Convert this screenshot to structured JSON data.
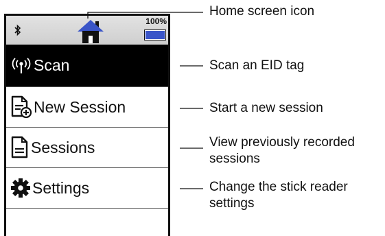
{
  "status_bar": {
    "battery_level": "100%",
    "battery_fill_fraction": 1.0,
    "battery_color": "#3a55c8",
    "home_icon_color": "#3a55c8",
    "icons": [
      "bluetooth-icon",
      "home-icon",
      "battery-icon"
    ]
  },
  "menu": {
    "items": [
      {
        "label": "Scan",
        "icon": "wireless-scan-icon",
        "selected": true
      },
      {
        "label": "New Session",
        "icon": "new-document-icon",
        "selected": false
      },
      {
        "label": "Sessions",
        "icon": "document-icon",
        "selected": false
      },
      {
        "label": "Settings",
        "icon": "gear-icon",
        "selected": false
      }
    ]
  },
  "callouts": {
    "home": "Home screen icon",
    "scan": "Scan an EID tag",
    "new_session": "Start a new session",
    "sessions_line1": "View previously recorded",
    "sessions_line2": "sessions",
    "settings_line1": "Change the stick reader",
    "settings_line2": "settings"
  }
}
